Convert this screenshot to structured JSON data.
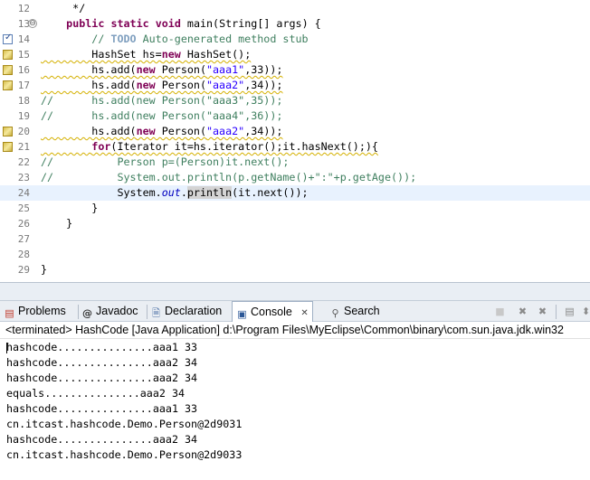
{
  "editor": {
    "lines": [
      {
        "n": "12",
        "marker": "",
        "fold": "",
        "text": "     */"
      },
      {
        "n": "13",
        "marker": "",
        "fold": "⊖",
        "text": "    public static void main(String[] args) {"
      },
      {
        "n": "14",
        "marker": "task",
        "fold": "",
        "text": "        // TODO Auto-generated method stub"
      },
      {
        "n": "15",
        "marker": "warn",
        "fold": "",
        "text": "        HashSet hs=new HashSet();"
      },
      {
        "n": "16",
        "marker": "warn",
        "fold": "",
        "text": "        hs.add(new Person(\"aaa1\",33));"
      },
      {
        "n": "17",
        "marker": "warn",
        "fold": "",
        "text": "        hs.add(new Person(\"aaa2\",34));"
      },
      {
        "n": "18",
        "marker": "",
        "fold": "",
        "text": "//      hs.add(new Person(\"aaa3\",35));"
      },
      {
        "n": "19",
        "marker": "",
        "fold": "",
        "text": "//      hs.add(new Person(\"aaa4\",36));"
      },
      {
        "n": "20",
        "marker": "warn",
        "fold": "",
        "text": "        hs.add(new Person(\"aaa2\",34));"
      },
      {
        "n": "21",
        "marker": "warn",
        "fold": "",
        "text": "        for(Iterator it=hs.iterator();it.hasNext();){"
      },
      {
        "n": "22",
        "marker": "",
        "fold": "",
        "text": "//          Person p=(Person)it.next();"
      },
      {
        "n": "23",
        "marker": "",
        "fold": "",
        "text": "//          System.out.println(p.getName()+\":\"+p.getAge());"
      },
      {
        "n": "24",
        "marker": "",
        "fold": "",
        "text": "            System.out.println(it.next());"
      },
      {
        "n": "25",
        "marker": "",
        "fold": "",
        "text": "        }"
      },
      {
        "n": "26",
        "marker": "",
        "fold": "",
        "text": "    }"
      },
      {
        "n": "27",
        "marker": "",
        "fold": "",
        "text": ""
      },
      {
        "n": "28",
        "marker": "",
        "fold": "",
        "text": ""
      },
      {
        "n": "29",
        "marker": "",
        "fold": "",
        "text": "}"
      }
    ]
  },
  "tabs": {
    "problems": "Problems",
    "javadoc": "Javadoc",
    "declaration": "Declaration",
    "console": "Console",
    "console_close": "✕",
    "search": "Search"
  },
  "console": {
    "status": "<terminated> HashCode [Java Application] d:\\Program Files\\MyEclipse\\Common\\binary\\com.sun.java.jdk.win32",
    "output": [
      "hashcode...............aaa1 33",
      "hashcode...............aaa2 34",
      "hashcode...............aaa2 34",
      "equals...............aaa2 34",
      "hashcode...............aaa1 33",
      "cn.itcast.hashcode.Demo.Person@2d9031",
      "hashcode...............aaa2 34",
      "cn.itcast.hashcode.Demo.Person@2d9033"
    ]
  },
  "icons": {
    "problems": "problems-icon",
    "javadoc": "javadoc-icon",
    "declaration": "declaration-icon",
    "console": "console-icon",
    "search": "search-icon"
  }
}
